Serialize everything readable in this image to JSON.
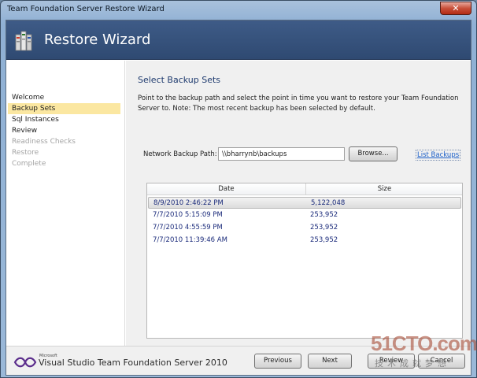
{
  "window": {
    "title": "Team Foundation Server Restore Wizard",
    "close_glyph": "✕"
  },
  "header": {
    "title": "Restore Wizard"
  },
  "nav": {
    "items": [
      {
        "label": "Welcome",
        "state": "normal"
      },
      {
        "label": "Backup Sets",
        "state": "active"
      },
      {
        "label": "Sql Instances",
        "state": "normal"
      },
      {
        "label": "Review",
        "state": "normal"
      },
      {
        "label": "Readiness Checks",
        "state": "disabled"
      },
      {
        "label": "Restore",
        "state": "disabled"
      },
      {
        "label": "Complete",
        "state": "disabled"
      }
    ]
  },
  "main": {
    "section_title": "Select Backup Sets",
    "instructions": "Point to the backup path and select the point in time you want to restore your Team Foundation Server to. Note: The most recent backup has been selected by default.",
    "path_label": "Network Backup Path:",
    "path_value": "\\\\bharrynb\\backups",
    "browse_label": "Browse...",
    "list_backups_label": "List Backups",
    "table": {
      "columns": [
        "Date",
        "Size"
      ],
      "rows": [
        {
          "date": "8/9/2010 2:46:22 PM",
          "size": "5,122,048",
          "selected": true
        },
        {
          "date": "7/7/2010 5:15:09 PM",
          "size": "253,952",
          "selected": false
        },
        {
          "date": "7/7/2010 4:55:59 PM",
          "size": "253,952",
          "selected": false
        },
        {
          "date": "7/7/2010 11:39:46 AM",
          "size": "253,952",
          "selected": false
        }
      ]
    }
  },
  "footer": {
    "brand_small": "Microsoft",
    "brand": "Visual Studio Team Foundation Server 2010",
    "previous_label": "Previous",
    "next_label": "Next",
    "review_label": "Review",
    "cancel_label": "Cancel"
  },
  "watermark": {
    "main": "51CTO.com",
    "sub": "技术成就梦想"
  },
  "colors": {
    "header_bg": "#2f4a72",
    "active_nav": "#fbe7a1",
    "link": "#1a5ec7",
    "row_text": "#1a2a7a"
  }
}
